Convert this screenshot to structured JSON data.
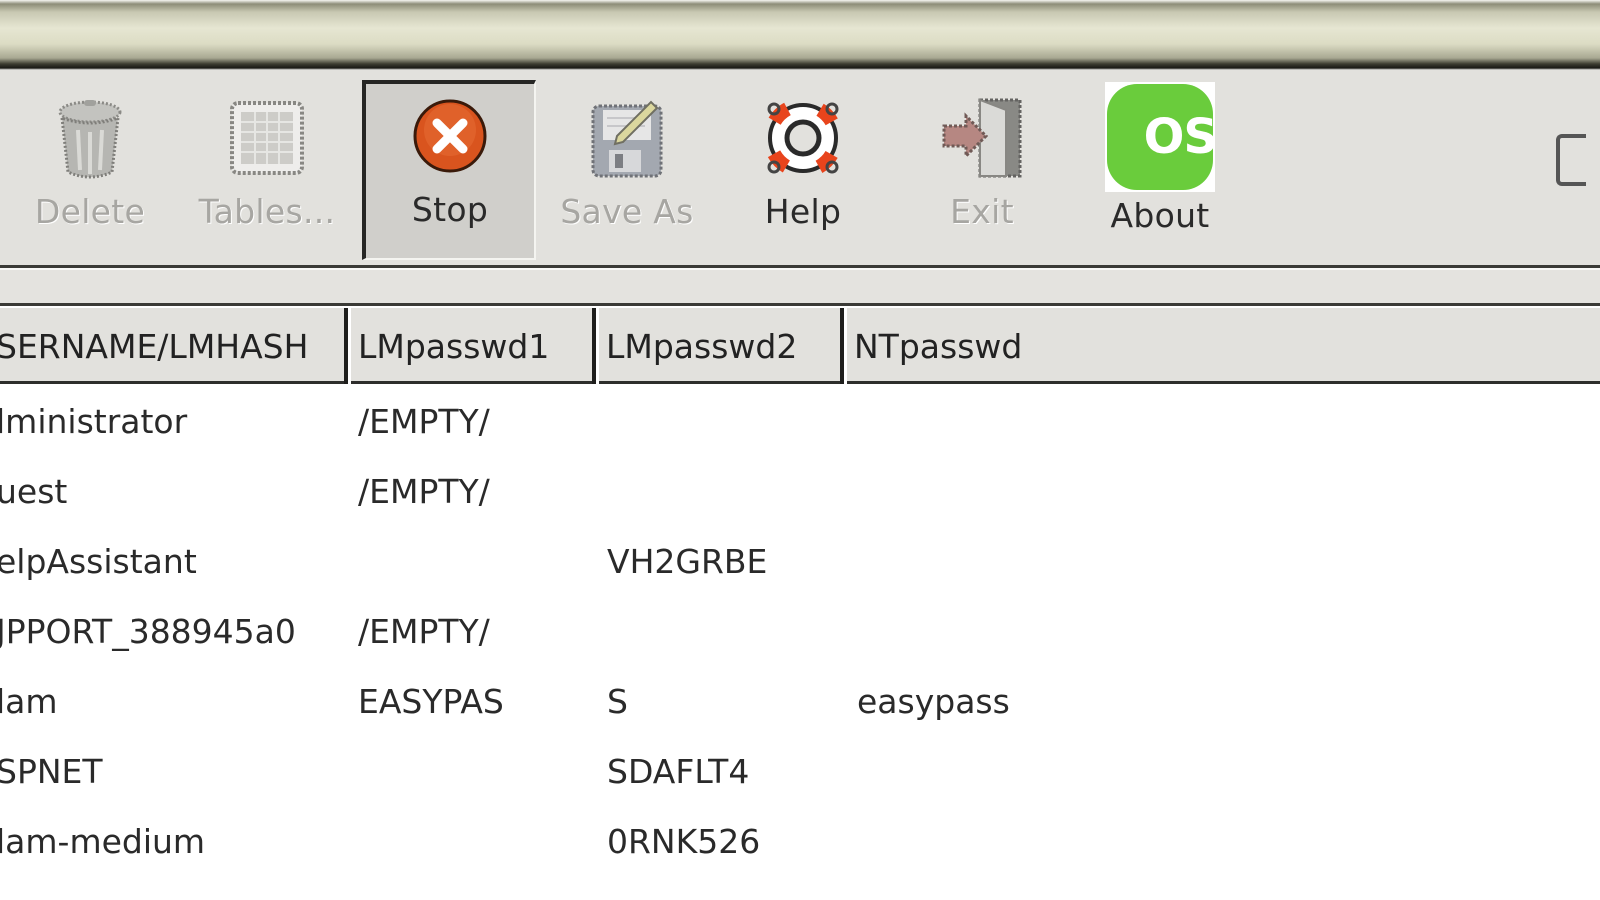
{
  "toolbar": {
    "buttons": [
      {
        "label": "Delete",
        "icon": "trash-icon",
        "state": "disabled"
      },
      {
        "label": "Tables...",
        "icon": "tables-icon",
        "state": "disabled"
      },
      {
        "label": "Stop",
        "icon": "stop-icon",
        "state": "pressed"
      },
      {
        "label": "Save As",
        "icon": "save-as-icon",
        "state": "disabled"
      },
      {
        "label": "Help",
        "icon": "lifebuoy-help-icon",
        "state": "enabled"
      },
      {
        "label": "Exit",
        "icon": "exit-door-icon",
        "state": "disabled"
      },
      {
        "label": "About",
        "icon": "os-logo-icon",
        "state": "enabled"
      }
    ],
    "about_logo_text": "OS"
  },
  "colors": {
    "stop_icon": "#d9541e",
    "about_logo": "#6acc3c",
    "help_ring_accent": "#e8441c",
    "toolbar_bg": "#e2e1dd"
  },
  "table": {
    "columns": [
      "SERNAME/LMHASH",
      "LMpasswd1",
      "LMpasswd2",
      "NTpasswd"
    ],
    "rows": [
      [
        "lministrator",
        "/EMPTY/",
        "",
        ""
      ],
      [
        "uest",
        "/EMPTY/",
        "",
        ""
      ],
      [
        "elpAssistant",
        "",
        "VH2GRBE",
        ""
      ],
      [
        "JPPORT_388945a0",
        "/EMPTY/",
        "",
        ""
      ],
      [
        "lam",
        "EASYPAS",
        "S",
        "easypass"
      ],
      [
        "SPNET",
        "",
        "SDAFLT4",
        ""
      ],
      [
        "lam-medium",
        "",
        "0RNK526",
        ""
      ]
    ]
  }
}
